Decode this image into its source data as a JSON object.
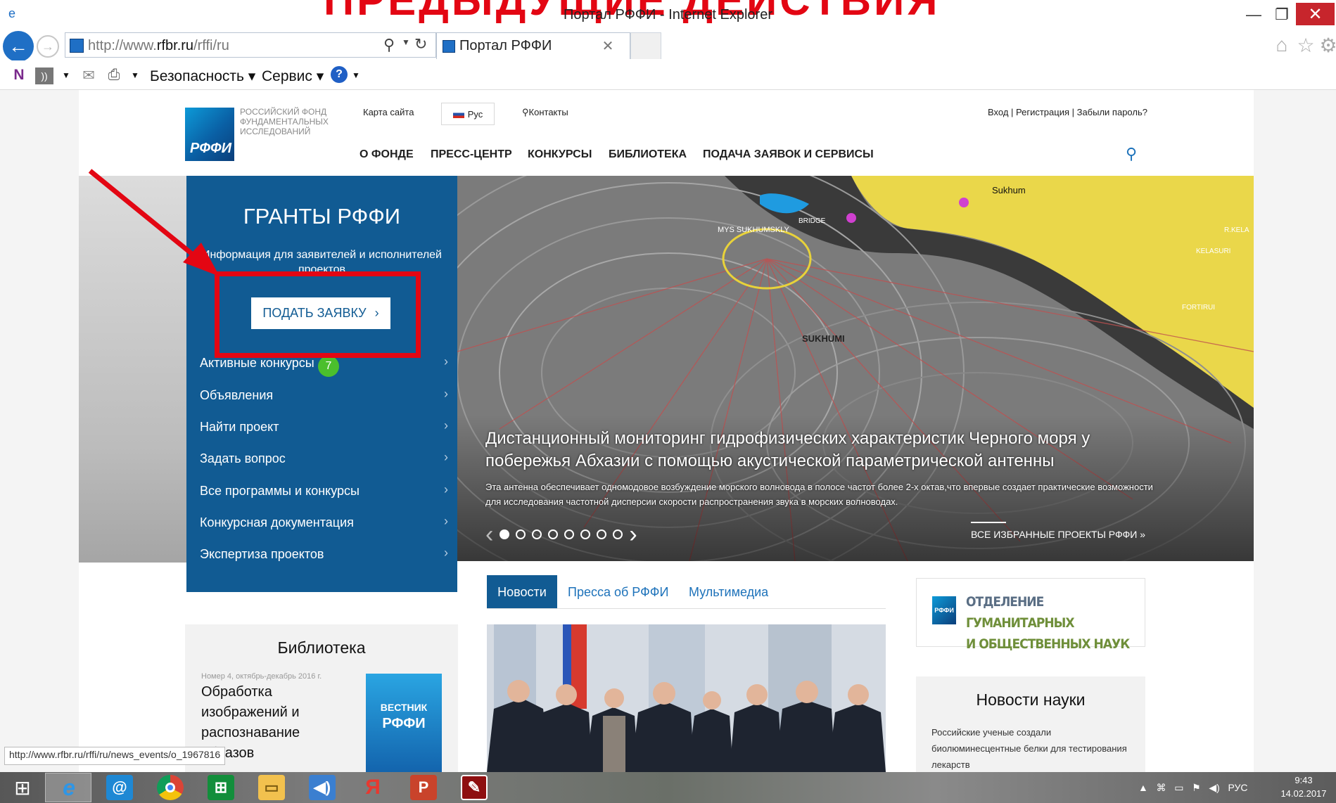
{
  "browser": {
    "window_title": "Портал РФФИ - Internet Explorer",
    "banner_overlay_text": "ПРЕДЫДУЩИЕ ДЕЙСТВИЯ",
    "address_prefix": "http://www.",
    "address_domain": "rfbr.ru",
    "address_suffix": "/rffi/ru",
    "tab_title": "Портал РФФИ",
    "menu_security": "Безопасность",
    "menu_service": "Сервис",
    "status_url": "http://www.rfbr.ru/rffi/ru/news_events/o_1967816"
  },
  "site": {
    "logo_text": "РФФИ",
    "org_name": "РОССИЙСКИЙ ФОНД ФУНДАМЕНТАЛЬНЫХ ИССЛЕДОВАНИЙ",
    "sitemap": "Карта сайта",
    "lang": "Рус",
    "contacts": "Контакты",
    "auth": "Вход | Регистрация | Забыли пароль?",
    "nav": [
      "О ФОНДЕ",
      "ПРЕСС-ЦЕНТР",
      "КОНКУРСЫ",
      "БИБЛИОТЕКА",
      "ПОДАЧА ЗАЯВОК И СЕРВИСЫ"
    ]
  },
  "grants": {
    "title": "ГРАНТЫ РФФИ",
    "subtitle": "Информация для заявителей и исполнителей проектов",
    "apply_button": "ПОДАТЬ ЗАЯВКУ",
    "active_badge": "7",
    "items": [
      "Активные конкурсы",
      "Объявления",
      "Найти проект",
      "Задать вопрос",
      "Все программы и конкурсы",
      "Конкурсная документация",
      "Экспертиза проектов"
    ]
  },
  "slider": {
    "title": "Дистанционный мониторинг гидрофизических характеристик Черного моря у побережья Абхазии с помощью акустической параметрической антенны",
    "text": "Эта антенна обеспечивает одномодовое возбуждение морского волновода в полосе частот более 2-х октав,что впервые создает практические возможности для исследования частотной дисперсии скорости распространения звука в морских волноводах.",
    "all_projects": "ВСЕ ИЗБРАННЫЕ ПРОЕКТЫ РФФИ »",
    "map_labels": [
      "SUKHUMI",
      "MYS SUKHUMSKLY",
      "BRIDGE",
      "KELASURI",
      "FORTIRUI",
      "R.KELA",
      "Sukhum"
    ],
    "dots_total": 8,
    "dots_active": 1
  },
  "news": {
    "tabs": [
      "Новости",
      "Пресса об РФФИ",
      "Мультимедиа"
    ]
  },
  "otdel": {
    "line1_a": "ОТДЕЛЕНИЕ ",
    "line1_b": "ГУМАНИТАРНЫХ",
    "line2": "И ОБЩЕСТВЕННЫХ НАУК",
    "logo": "РФФИ"
  },
  "library": {
    "title": "Библиотека",
    "issue": "Номер 4, октябрь-декабрь 2016 г.",
    "article": "Обработка изображений и распознавание образов",
    "cover_line1": "ВЕСТНИК",
    "cover_line2": "РФФИ"
  },
  "science": {
    "title": "Новости науки",
    "text": "Российские ученые создали биолюминесцентные белки для тестирования лекарств"
  },
  "taskbar": {
    "lang": "РУС",
    "time": "9:43",
    "date": "14.02.2017"
  },
  "colors": {
    "grant_panel": "#115b93",
    "accent_red": "#e30613",
    "link_blue": "#1d72ba",
    "badge_green": "#4bbf2d"
  }
}
